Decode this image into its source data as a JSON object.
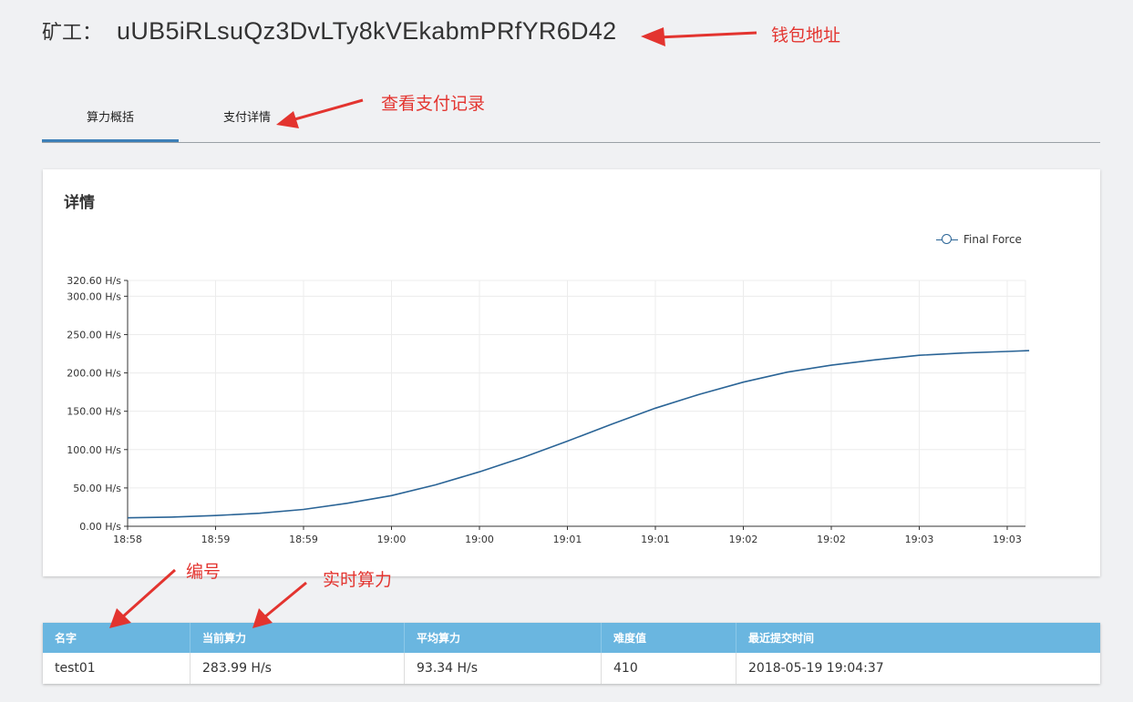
{
  "header": {
    "miner_label": "矿工：",
    "address": "uUB5iRLsuQz3DvLTy8kVEkabmPRfYR6D42"
  },
  "tabs": [
    {
      "label": "算力概括",
      "active": true
    },
    {
      "label": "支付详情",
      "active": false
    }
  ],
  "annotations": {
    "wallet": "钱包地址",
    "payments": "查看支付记录",
    "id": "编号",
    "hashrate": "实时算力",
    "color": "#e3342f"
  },
  "card": {
    "title": "详情"
  },
  "chart_data": {
    "type": "line",
    "title": "",
    "xlabel": "",
    "ylabel": "",
    "ylim": [
      0,
      320.6
    ],
    "y_ticks": [
      "0.00 H/s",
      "50.00 H/s",
      "100.00 H/s",
      "150.00 H/s",
      "200.00 H/s",
      "250.00 H/s",
      "300.00 H/s",
      "320.60 H/s"
    ],
    "y_tick_values": [
      0,
      50,
      100,
      150,
      200,
      250,
      300,
      320.6
    ],
    "x_ticks": [
      "18:58",
      "18:59",
      "18:59",
      "19:00",
      "19:00",
      "19:01",
      "19:01",
      "19:02",
      "19:02",
      "19:03",
      "19:03"
    ],
    "legend": "top-right",
    "grid": true,
    "color": "#2a6496",
    "series": [
      {
        "name": "Final Force",
        "x": [
          0,
          0.5,
          1,
          1.5,
          2,
          2.5,
          3,
          3.5,
          4,
          4.5,
          5,
          5.5,
          6,
          6.5,
          7,
          7.5,
          8,
          8.5,
          9,
          9.5,
          10,
          10.25
        ],
        "values": [
          11,
          12,
          14,
          17,
          22,
          30,
          40,
          54,
          71,
          90,
          111,
          133,
          154,
          172,
          188,
          201,
          210,
          217,
          223,
          226,
          228,
          229
        ]
      }
    ]
  },
  "table": {
    "header_color": "#6ab6e0",
    "headers": [
      "名字",
      "当前算力",
      "平均算力",
      "难度值",
      "最近提交时间"
    ],
    "rows": [
      [
        "test01",
        "283.99 H/s",
        "93.34 H/s",
        "410",
        "2018-05-19 19:04:37"
      ]
    ]
  }
}
